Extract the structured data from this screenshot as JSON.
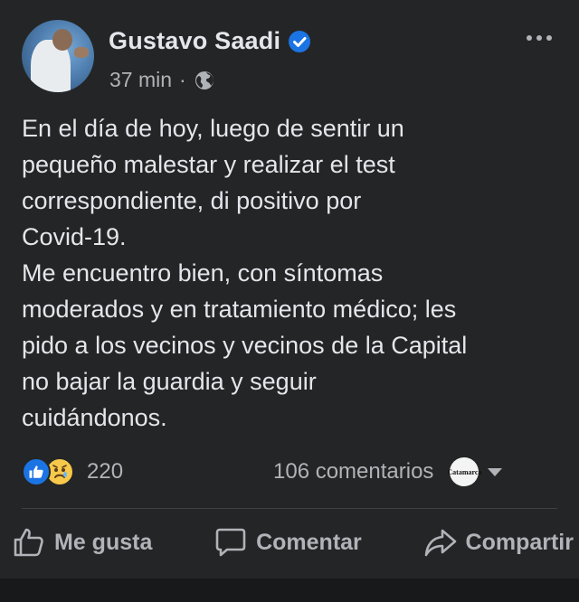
{
  "post": {
    "author": "Gustavo Saadi",
    "timestamp": "37 min",
    "separator": "·",
    "audience_icon": "globe-icon",
    "text": "En el día de hoy, luego de sentir un\npequeño malestar y realizar el test\ncorrespondiente, di positivo por\nCovid-19.\nMe encuentro bien, con síntomas\nmoderados y en tratamiento médico; les\npido a los vecinos y vecinos de la Capital\nno bajar la guardia y seguir\ncuidándonos."
  },
  "reactions": {
    "count": "220",
    "icons": [
      "like-icon",
      "sad-icon"
    ]
  },
  "comments": {
    "count_label": "106 comentarios",
    "page_avatar_text": "Catamarca"
  },
  "actions": {
    "like_label": "Me gusta",
    "comment_label": "Comentar",
    "share_label": "Compartir"
  },
  "colors": {
    "background": "#242526",
    "text": "#e4e6eb",
    "secondary_text": "#b0b3b8",
    "verified_blue": "#1b74e4",
    "like_blue": "#1b74e4",
    "divider": "#3e4042"
  }
}
